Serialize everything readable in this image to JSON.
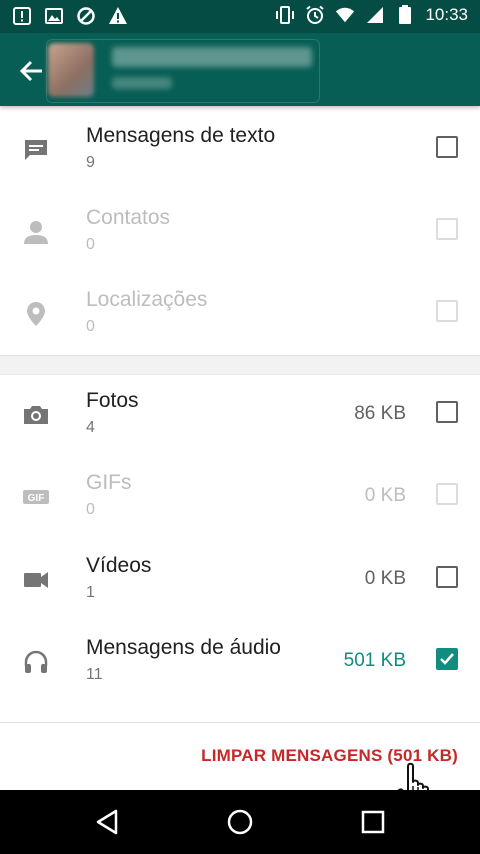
{
  "status_bar": {
    "time": "10:33",
    "left_icons": [
      "notification-alert-icon",
      "image-icon",
      "blocked-icon",
      "warning-icon"
    ],
    "right_icons": [
      "vibrate-icon",
      "alarm-icon",
      "wifi-icon",
      "signal-icon",
      "battery-icon"
    ]
  },
  "header": {
    "back_icon": "arrow-left-icon"
  },
  "items": [
    {
      "label": "Mensagens de texto",
      "count": "9",
      "size": "",
      "icon": "message-icon",
      "enabled": true,
      "checked": false
    },
    {
      "label": "Contatos",
      "count": "0",
      "size": "",
      "icon": "person-icon",
      "enabled": false,
      "checked": false
    },
    {
      "label": "Localizações",
      "count": "0",
      "size": "",
      "icon": "location-pin-icon",
      "enabled": false,
      "checked": false
    },
    {
      "label": "Fotos",
      "count": "4",
      "size": "86 KB",
      "icon": "camera-icon",
      "enabled": true,
      "checked": false
    },
    {
      "label": "GIFs",
      "count": "0",
      "size": "0 KB",
      "icon": "gif-icon",
      "enabled": false,
      "checked": false
    },
    {
      "label": "Vídeos",
      "count": "1",
      "size": "0 KB",
      "icon": "video-camera-icon",
      "enabled": true,
      "checked": false
    },
    {
      "label": "Mensagens de áudio",
      "count": "11",
      "size": "501 KB",
      "icon": "headphones-icon",
      "enabled": true,
      "checked": true
    }
  ],
  "action": {
    "clear_label": "LIMPAR MENSAGENS (501 KB)"
  },
  "colors": {
    "toolbar": "#075e54",
    "statusbar": "#054d44",
    "accent": "#128c7e",
    "danger": "#c62828"
  },
  "navigation": [
    "back-triangle-icon",
    "home-circle-icon",
    "recents-square-icon"
  ]
}
